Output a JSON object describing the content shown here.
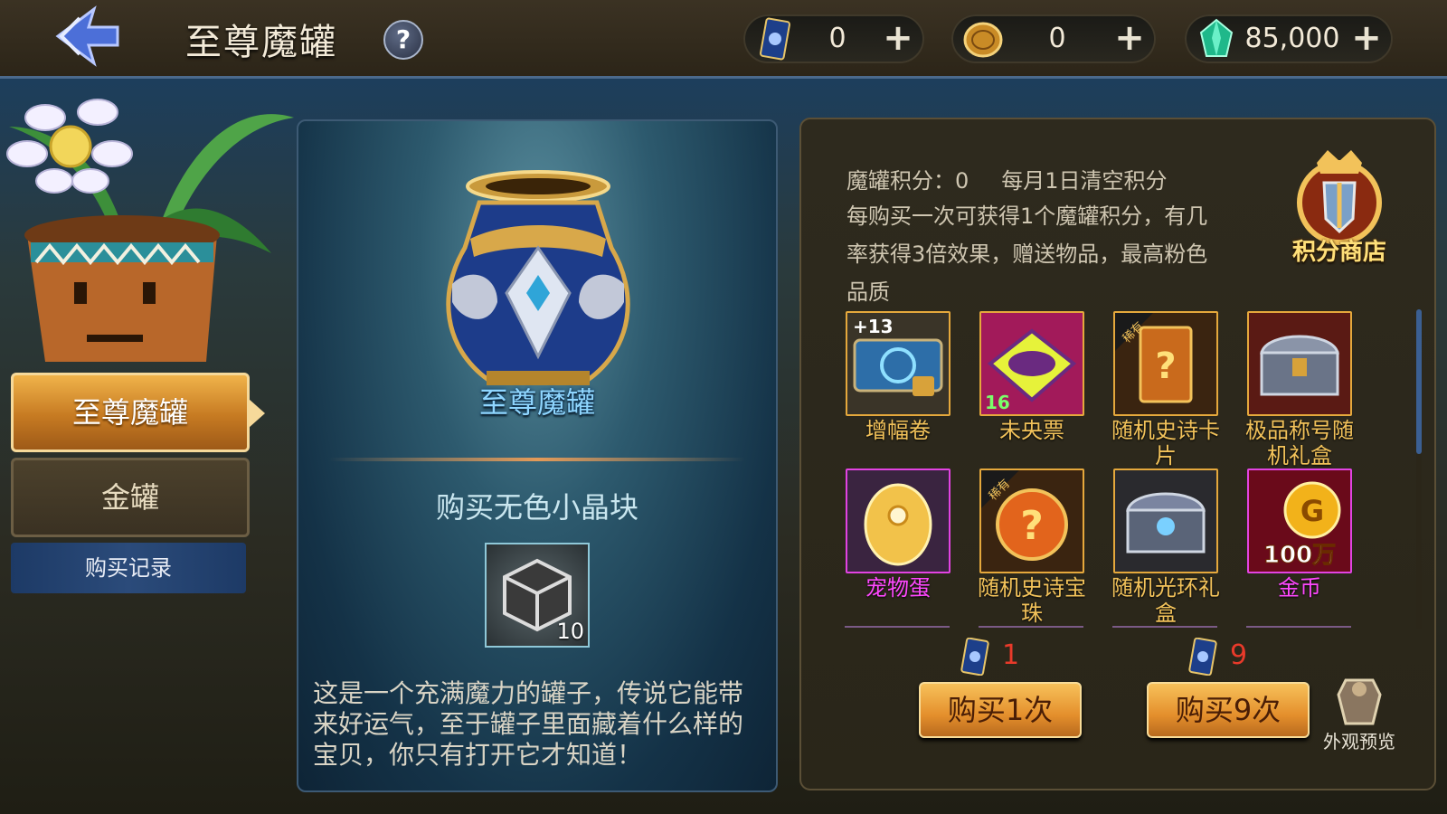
{
  "header": {
    "title": "至尊魔罐",
    "help_label": "?",
    "currencies": [
      {
        "icon": "card-ticket-icon",
        "value": "0",
        "plus": "+"
      },
      {
        "icon": "gold-coin-icon",
        "value": "0",
        "plus": "+"
      },
      {
        "icon": "green-crystal-icon",
        "value": "85,000",
        "plus": "+"
      }
    ]
  },
  "sidebar": {
    "tabs": [
      {
        "label": "至尊魔罐",
        "active": true
      },
      {
        "label": "金罐",
        "active": false
      }
    ],
    "history_label": "购买记录"
  },
  "jar": {
    "name": "至尊魔罐",
    "buy_item_title": "购买无色小晶块",
    "buy_item_qty": "10",
    "description": "这是一个充满魔力的罐子，传说它能带来好运气，至于罐子里面藏着什么样的宝贝，你只有打开它才知道！"
  },
  "points": {
    "label": "魔罐积分：",
    "value": "0",
    "reset_note": "每月1日清空积分",
    "description": "每购买一次可获得1个魔罐积分，有几率获得3倍效果，赠送物品，最高粉色品质",
    "shop_label": "积分商店"
  },
  "rewards": [
    {
      "name": "增幅卷",
      "rarity": "gold",
      "badge": "+13",
      "icon": "amplify-scroll-icon"
    },
    {
      "name": "未央票",
      "rarity": "gold",
      "badge": "16",
      "icon": "weiyang-ticket-icon"
    },
    {
      "name": "随机史诗卡片",
      "rarity": "gold",
      "badge": "稀有",
      "icon": "epic-card-icon"
    },
    {
      "name": "极品称号随机礼盒",
      "rarity": "gold",
      "badge": "",
      "icon": "title-chest-icon"
    },
    {
      "name": "宠物蛋",
      "rarity": "pink",
      "badge": "",
      "icon": "pet-egg-icon"
    },
    {
      "name": "随机史诗宝珠",
      "rarity": "gold",
      "badge": "稀有",
      "icon": "epic-orb-icon"
    },
    {
      "name": "随机光环礼盒",
      "rarity": "gold",
      "badge": "",
      "icon": "aura-chest-icon"
    },
    {
      "name": "金币",
      "rarity": "pink",
      "badge": "100万",
      "icon": "gold-pile-icon"
    }
  ],
  "purchase": {
    "single": {
      "cost": "1",
      "label": "购买1次"
    },
    "multi": {
      "cost": "9",
      "label": "购买9次"
    },
    "preview_label": "外观预览"
  },
  "colors": {
    "accent_gold": "#f2c25a",
    "rarity_pink": "#ff48ff",
    "cost_red": "#e83a2a",
    "jar_name_blue": "#8fd6ff"
  }
}
